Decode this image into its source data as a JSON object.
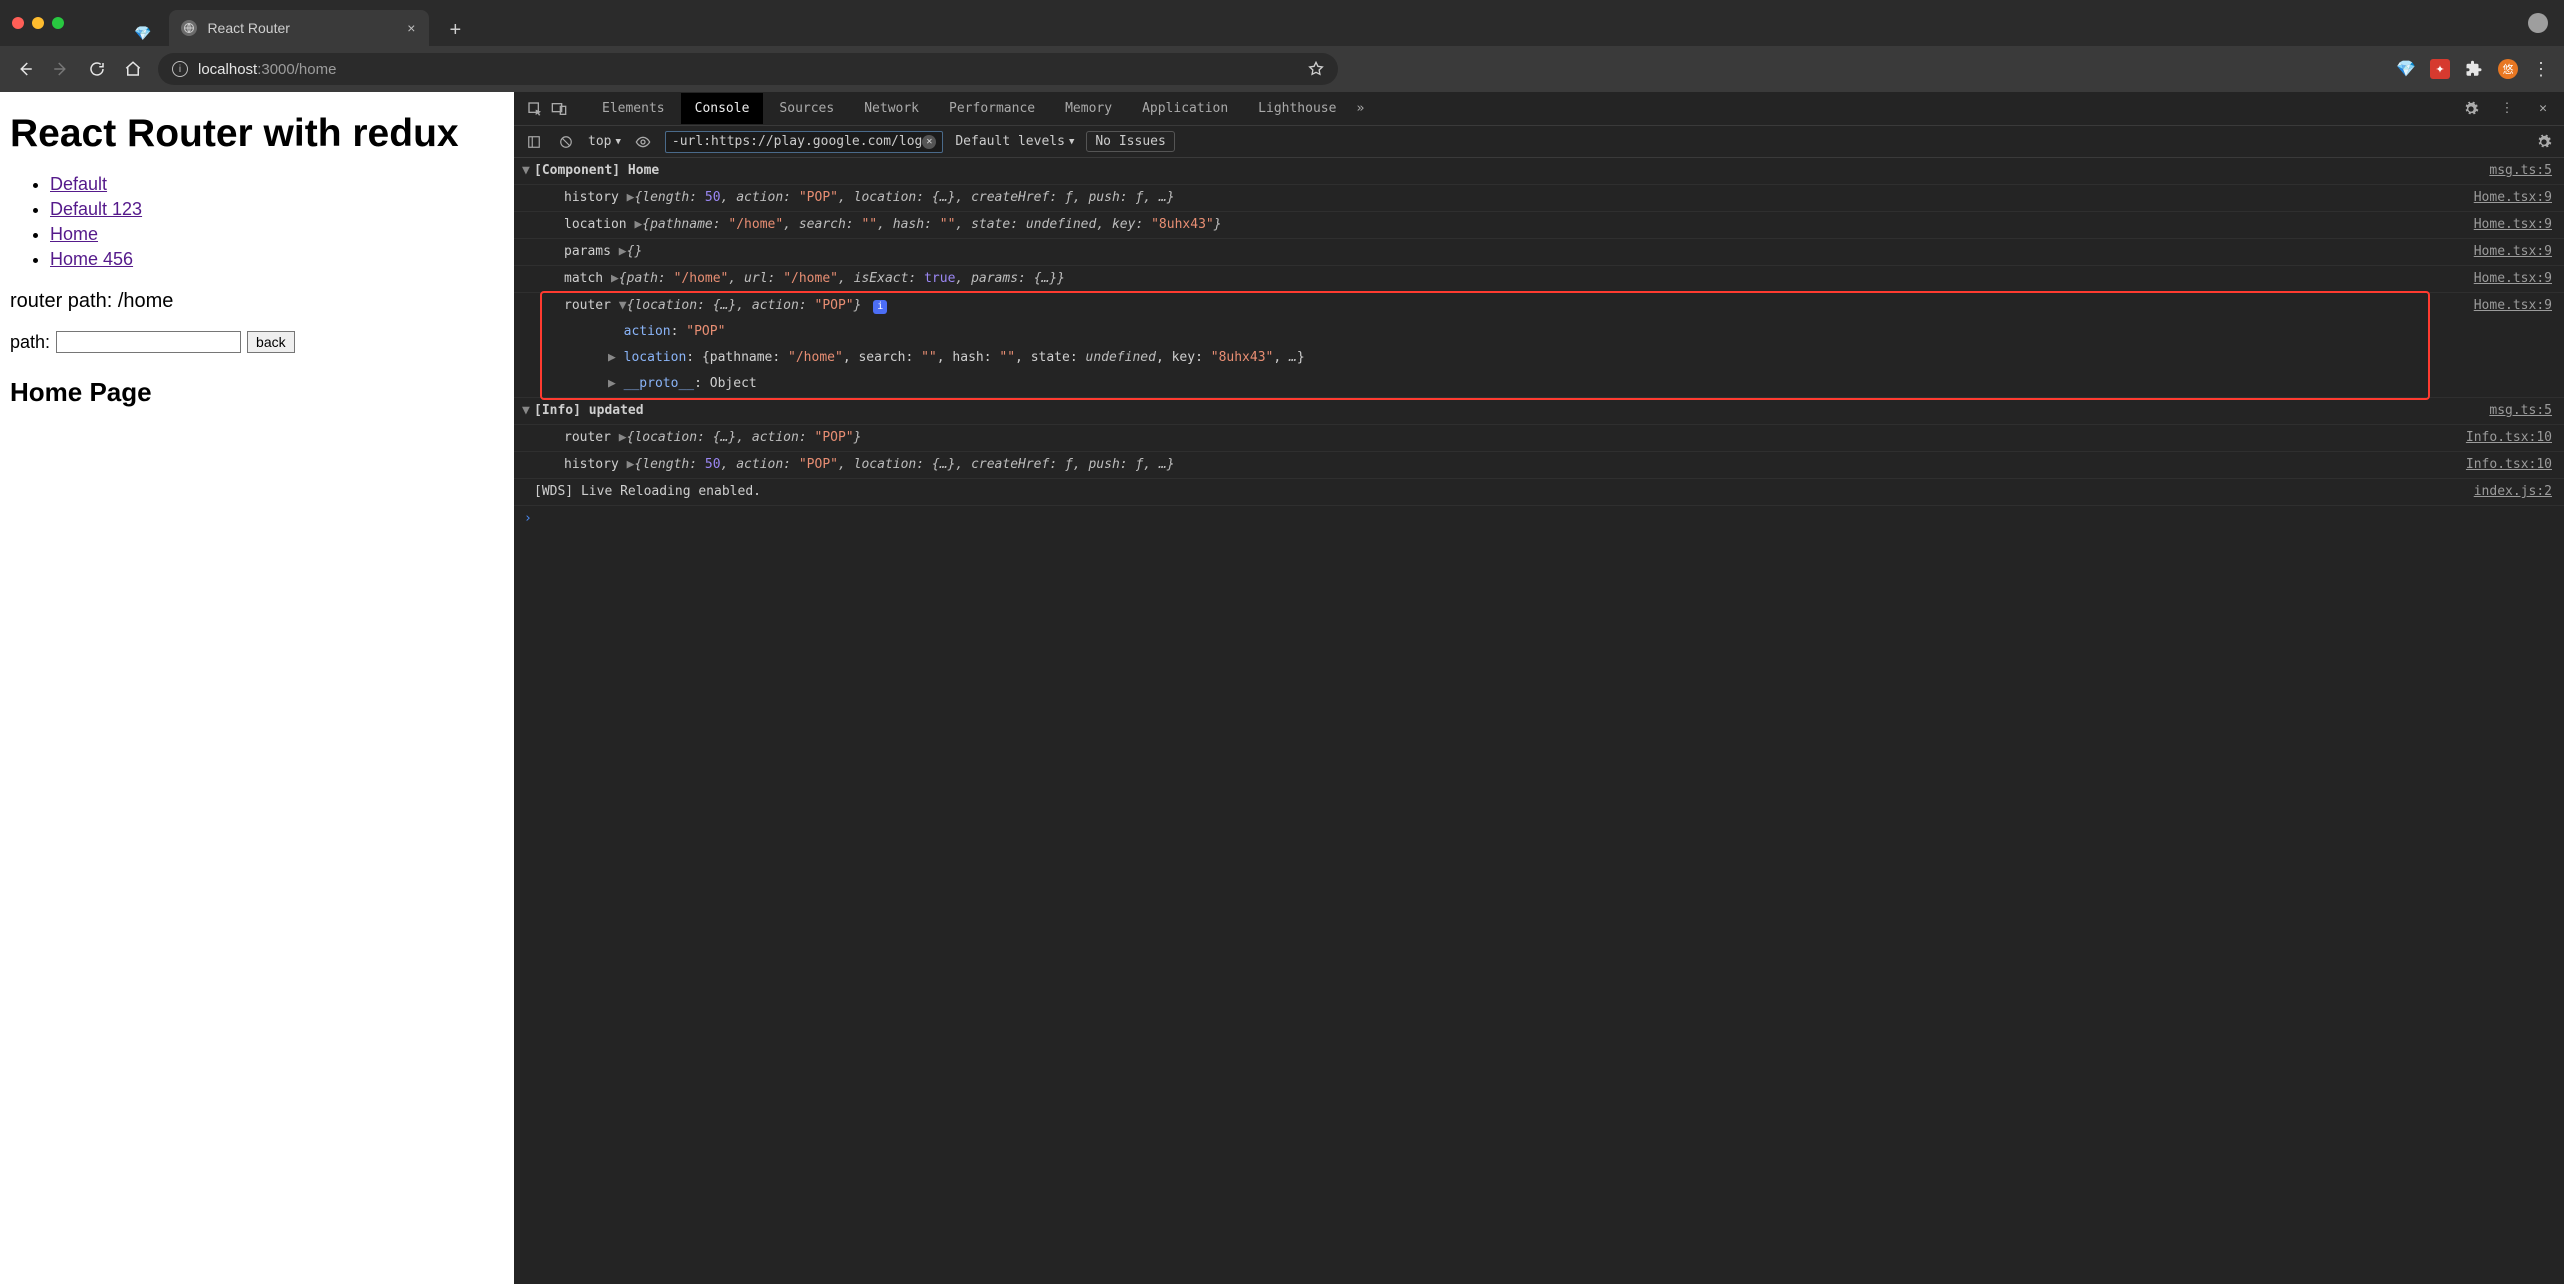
{
  "window": {
    "tab_title": "React Router",
    "new_tab_plus": "+",
    "close_x": "×"
  },
  "address": {
    "host": "localhost",
    "port_path": ":3000/home"
  },
  "page": {
    "h1": "React Router with redux",
    "links": [
      "Default",
      "Default 123",
      "Home",
      "Home 456"
    ],
    "router_path_label": "router path: /home",
    "path_label": "path:",
    "path_value": "",
    "back_btn": "back",
    "h2": "Home Page"
  },
  "devtools": {
    "tabs": [
      "Elements",
      "Console",
      "Sources",
      "Network",
      "Performance",
      "Memory",
      "Application",
      "Lighthouse"
    ],
    "active_tab": "Console",
    "context": "top",
    "filter": "-url:https://play.google.com/log",
    "levels": "Default levels",
    "issues": "No Issues"
  },
  "log": {
    "r0": {
      "text": "[Component] Home",
      "src": "msg.ts:5"
    },
    "r1": {
      "label": "history",
      "src": "Home.tsx:9"
    },
    "r2": {
      "label": "location",
      "src": "Home.tsx:9"
    },
    "r3": {
      "label": "params",
      "src": "Home.tsx:9"
    },
    "r4": {
      "label": "match",
      "src": "Home.tsx:9"
    },
    "r5": {
      "label": "router",
      "src": "Home.tsx:9"
    },
    "r6": {
      "action_key": "action",
      "action_val": "\"POP\""
    },
    "r7": {
      "loc_key": "location"
    },
    "r8": {
      "proto_key": "__proto__",
      "proto_val": "Object"
    },
    "r9": {
      "text": "[Info] updated",
      "src": "msg.ts:5"
    },
    "r10": {
      "label": "router",
      "src": "Info.tsx:10"
    },
    "r11": {
      "label": "history",
      "src": "Info.tsx:10"
    },
    "r12": {
      "text": "[WDS] Live Reloading enabled.",
      "src": "index.js:2"
    }
  },
  "vals": {
    "fifty": "50",
    "pop": "\"POP\"",
    "home": "\"/home\"",
    "empty": "\"\"",
    "undef": "undefined",
    "true": "true",
    "key": "\"8uhx43\"",
    "f": "ƒ",
    "dots": "…",
    "objdots": "{…}"
  }
}
